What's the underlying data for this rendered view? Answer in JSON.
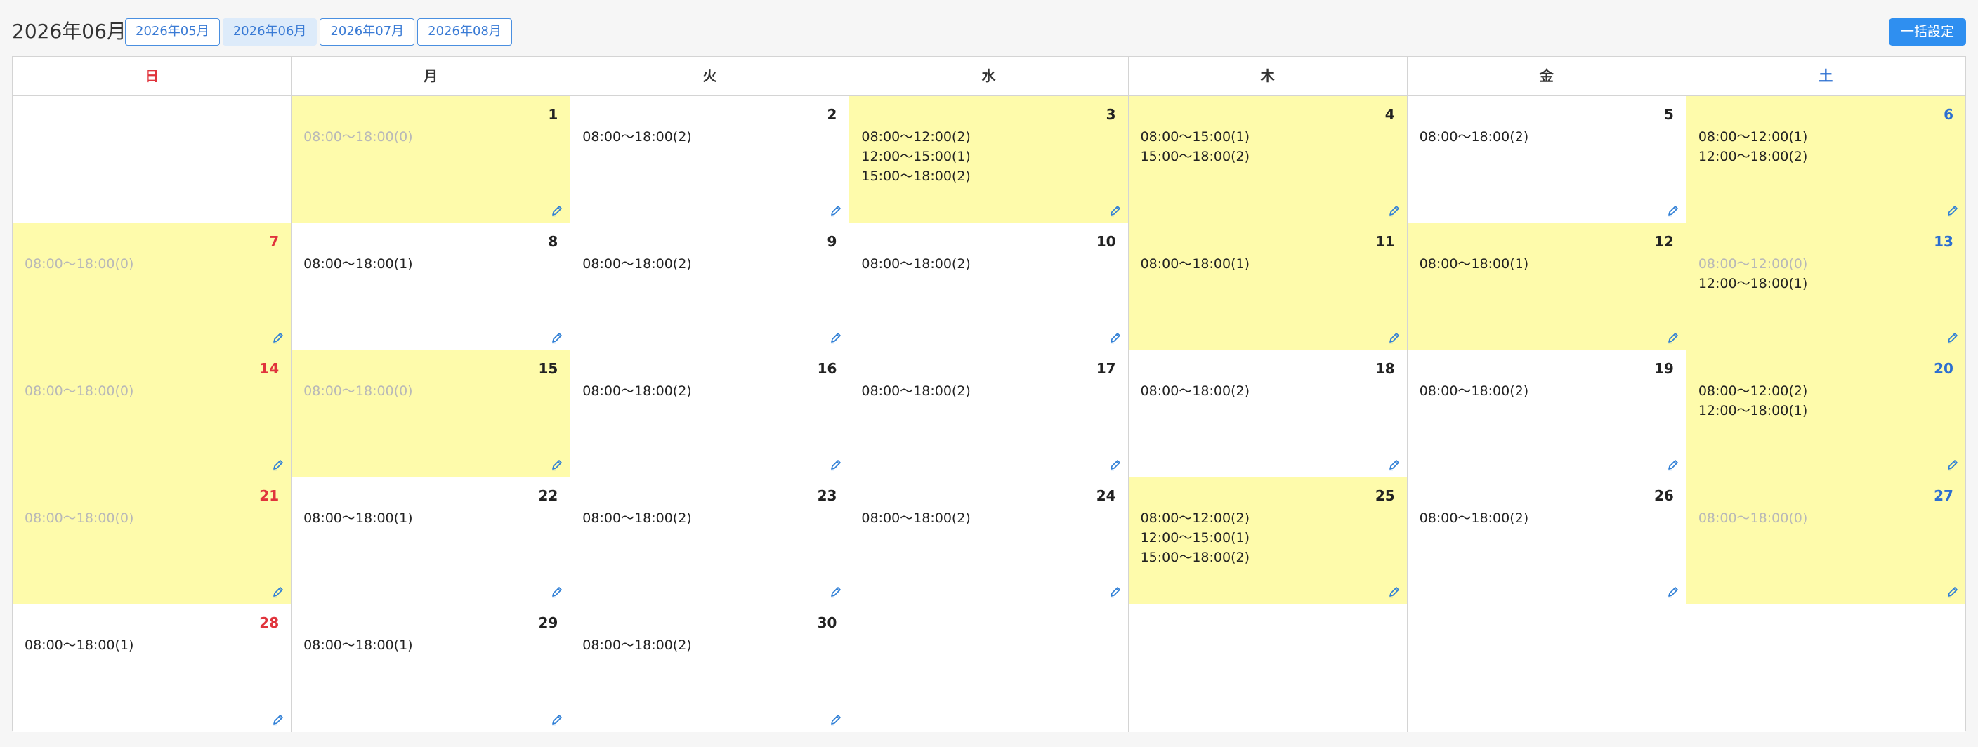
{
  "header": {
    "title": "2026年06月",
    "month_tabs": [
      {
        "label": "2026年05月",
        "active": false
      },
      {
        "label": "2026年06月",
        "active": true
      },
      {
        "label": "2026年07月",
        "active": false
      },
      {
        "label": "2026年08月",
        "active": false
      }
    ],
    "bulk_button_label": "一括設定"
  },
  "weekdays": [
    {
      "label": "日",
      "kind": "sun"
    },
    {
      "label": "月",
      "kind": ""
    },
    {
      "label": "火",
      "kind": ""
    },
    {
      "label": "水",
      "kind": ""
    },
    {
      "label": "木",
      "kind": ""
    },
    {
      "label": "金",
      "kind": ""
    },
    {
      "label": "土",
      "kind": "sat"
    }
  ],
  "colors": {
    "highlight_background": "#fefbab",
    "sunday": "#e0343c",
    "saturday": "#2c6fd1",
    "accent": "#2f8ff0",
    "dim_text": "#b8b8b8"
  },
  "weeks": [
    [
      null,
      {
        "day": "1",
        "highlight": true,
        "slots": [
          {
            "text": "08:00〜18:00(0)",
            "dim": true
          }
        ]
      },
      {
        "day": "2",
        "highlight": false,
        "slots": [
          {
            "text": "08:00〜18:00(2)",
            "dim": false
          }
        ]
      },
      {
        "day": "3",
        "highlight": true,
        "slots": [
          {
            "text": "08:00〜12:00(2)",
            "dim": false
          },
          {
            "text": "12:00〜15:00(1)",
            "dim": false
          },
          {
            "text": "15:00〜18:00(2)",
            "dim": false
          }
        ]
      },
      {
        "day": "4",
        "highlight": true,
        "slots": [
          {
            "text": "08:00〜15:00(1)",
            "dim": false
          },
          {
            "text": "15:00〜18:00(2)",
            "dim": false
          }
        ]
      },
      {
        "day": "5",
        "highlight": false,
        "slots": [
          {
            "text": "08:00〜18:00(2)",
            "dim": false
          }
        ]
      },
      {
        "day": "6",
        "highlight": true,
        "slots": [
          {
            "text": "08:00〜12:00(1)",
            "dim": false
          },
          {
            "text": "12:00〜18:00(2)",
            "dim": false
          }
        ]
      }
    ],
    [
      {
        "day": "7",
        "highlight": true,
        "slots": [
          {
            "text": "08:00〜18:00(0)",
            "dim": true
          }
        ]
      },
      {
        "day": "8",
        "highlight": false,
        "slots": [
          {
            "text": "08:00〜18:00(1)",
            "dim": false
          }
        ]
      },
      {
        "day": "9",
        "highlight": false,
        "slots": [
          {
            "text": "08:00〜18:00(2)",
            "dim": false
          }
        ]
      },
      {
        "day": "10",
        "highlight": false,
        "slots": [
          {
            "text": "08:00〜18:00(2)",
            "dim": false
          }
        ]
      },
      {
        "day": "11",
        "highlight": true,
        "slots": [
          {
            "text": "08:00〜18:00(1)",
            "dim": false
          }
        ]
      },
      {
        "day": "12",
        "highlight": true,
        "slots": [
          {
            "text": "08:00〜18:00(1)",
            "dim": false
          }
        ]
      },
      {
        "day": "13",
        "highlight": true,
        "slots": [
          {
            "text": "08:00〜12:00(0)",
            "dim": true
          },
          {
            "text": "12:00〜18:00(1)",
            "dim": false
          }
        ]
      }
    ],
    [
      {
        "day": "14",
        "highlight": true,
        "slots": [
          {
            "text": "08:00〜18:00(0)",
            "dim": true
          }
        ]
      },
      {
        "day": "15",
        "highlight": true,
        "slots": [
          {
            "text": "08:00〜18:00(0)",
            "dim": true
          }
        ]
      },
      {
        "day": "16",
        "highlight": false,
        "slots": [
          {
            "text": "08:00〜18:00(2)",
            "dim": false
          }
        ]
      },
      {
        "day": "17",
        "highlight": false,
        "slots": [
          {
            "text": "08:00〜18:00(2)",
            "dim": false
          }
        ]
      },
      {
        "day": "18",
        "highlight": false,
        "slots": [
          {
            "text": "08:00〜18:00(2)",
            "dim": false
          }
        ]
      },
      {
        "day": "19",
        "highlight": false,
        "slots": [
          {
            "text": "08:00〜18:00(2)",
            "dim": false
          }
        ]
      },
      {
        "day": "20",
        "highlight": true,
        "slots": [
          {
            "text": "08:00〜12:00(2)",
            "dim": false
          },
          {
            "text": "12:00〜18:00(1)",
            "dim": false
          }
        ]
      }
    ],
    [
      {
        "day": "21",
        "highlight": true,
        "slots": [
          {
            "text": "08:00〜18:00(0)",
            "dim": true
          }
        ]
      },
      {
        "day": "22",
        "highlight": false,
        "slots": [
          {
            "text": "08:00〜18:00(1)",
            "dim": false
          }
        ]
      },
      {
        "day": "23",
        "highlight": false,
        "slots": [
          {
            "text": "08:00〜18:00(2)",
            "dim": false
          }
        ]
      },
      {
        "day": "24",
        "highlight": false,
        "slots": [
          {
            "text": "08:00〜18:00(2)",
            "dim": false
          }
        ]
      },
      {
        "day": "25",
        "highlight": true,
        "slots": [
          {
            "text": "08:00〜12:00(2)",
            "dim": false
          },
          {
            "text": "12:00〜15:00(1)",
            "dim": false
          },
          {
            "text": "15:00〜18:00(2)",
            "dim": false
          }
        ]
      },
      {
        "day": "26",
        "highlight": false,
        "slots": [
          {
            "text": "08:00〜18:00(2)",
            "dim": false
          }
        ]
      },
      {
        "day": "27",
        "highlight": true,
        "slots": [
          {
            "text": "08:00〜18:00(0)",
            "dim": true
          }
        ]
      }
    ],
    [
      {
        "day": "28",
        "highlight": false,
        "slots": [
          {
            "text": "08:00〜18:00(1)",
            "dim": false
          }
        ]
      },
      {
        "day": "29",
        "highlight": false,
        "slots": [
          {
            "text": "08:00〜18:00(1)",
            "dim": false
          }
        ]
      },
      {
        "day": "30",
        "highlight": false,
        "slots": [
          {
            "text": "08:00〜18:00(2)",
            "dim": false
          }
        ]
      },
      null,
      null,
      null,
      null
    ]
  ],
  "edit_icon": "pencil-icon"
}
